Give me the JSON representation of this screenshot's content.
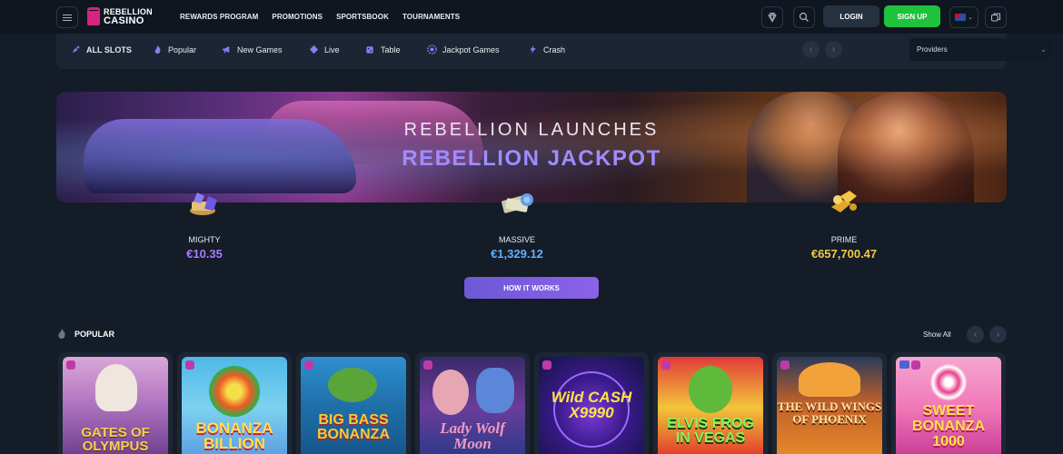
{
  "header": {
    "logo_line1": "REBELLION",
    "logo_line2": "CASINO",
    "nav": [
      "REWARDS PROGRAM",
      "PROMOTIONS",
      "SPORTSBOOK",
      "TOURNAMENTS"
    ],
    "login": "LOGIN",
    "signup": "SIGN UP",
    "icons": [
      "menu-icon",
      "bonus-gem-icon",
      "search-icon",
      "flag-icon",
      "chat-icon"
    ]
  },
  "categories": [
    {
      "label": "ALL SLOTS",
      "icon": "rocket-icon"
    },
    {
      "label": "Popular",
      "icon": "flame-icon"
    },
    {
      "label": "New Games",
      "icon": "megaphone-icon"
    },
    {
      "label": "Live",
      "icon": "diamond-icon"
    },
    {
      "label": "Table",
      "icon": "dice-icon"
    },
    {
      "label": "Jackpot Games",
      "icon": "chip-icon"
    },
    {
      "label": "Crash",
      "icon": "bolt-icon"
    }
  ],
  "providers_select": "Providers",
  "banner": {
    "line1": "REBELLION LAUNCHES",
    "line2": "REBELLION JACKPOT"
  },
  "jackpots": [
    {
      "name": "MIGHTY",
      "value": "€10.35",
      "color": "#a77bff"
    },
    {
      "name": "MASSIVE",
      "value": "€1,329.12",
      "color": "#5fb0ff"
    },
    {
      "name": "PRIME",
      "value": "€657,700.47",
      "color": "#f2c842"
    }
  ],
  "how_it_works": "HOW IT WORKS",
  "popular": {
    "title": "POPULAR",
    "show_all": "Show All",
    "games": [
      {
        "title": "GATES OF OLYMPUS"
      },
      {
        "title": "BONANZA BILLION"
      },
      {
        "title": "BIG BASS BONANZA"
      },
      {
        "title": "Lady Wolf Moon"
      },
      {
        "title": "Wild CASH X9990"
      },
      {
        "title": "ELVIS FROG IN VEGAS"
      },
      {
        "title": "THE WILD WINGS OF PHOENIX"
      },
      {
        "title": "SWEET BONANZA 1000"
      }
    ]
  }
}
